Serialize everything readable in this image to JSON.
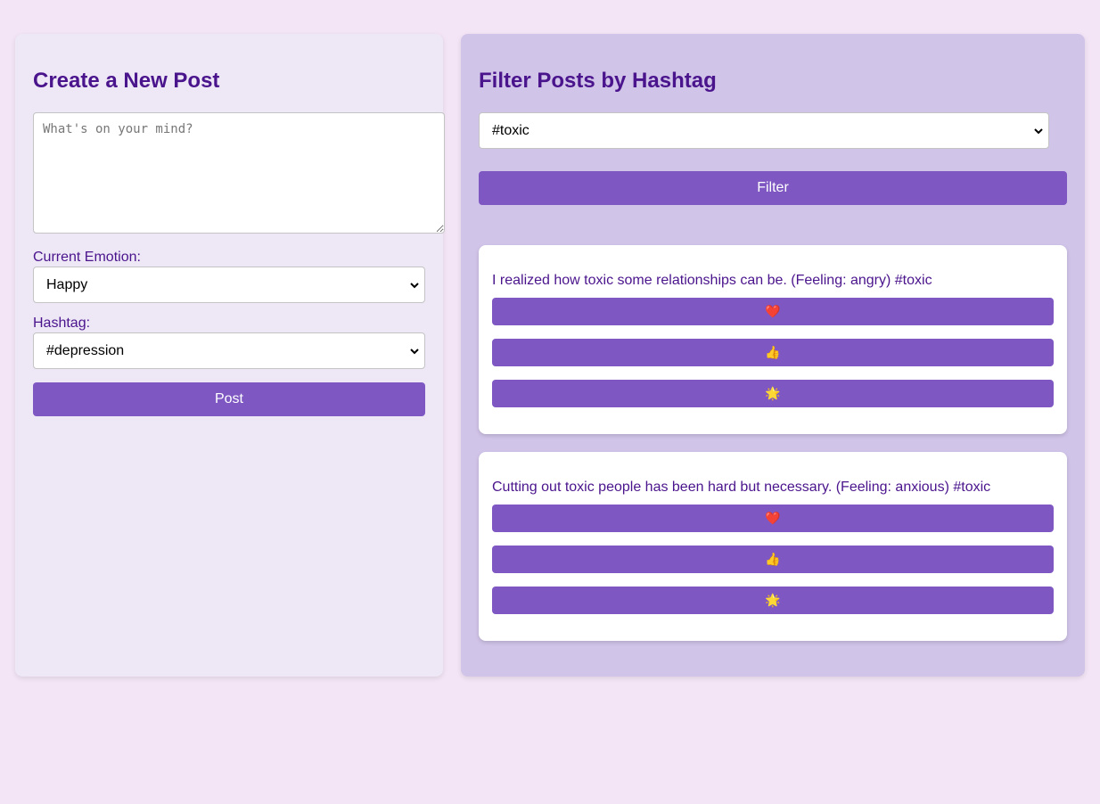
{
  "create_panel": {
    "title": "Create a New Post",
    "textarea_placeholder": "What's on your mind?",
    "emotion_label": "Current Emotion:",
    "emotion_selected": "Happy",
    "hashtag_label": "Hashtag:",
    "hashtag_selected": "#depression",
    "post_button": "Post"
  },
  "filter_panel": {
    "title": "Filter Posts by Hashtag",
    "hashtag_selected": "#toxic",
    "filter_button": "Filter"
  },
  "posts": [
    {
      "text": "I realized how toxic some relationships can be. (Feeling: angry) #toxic",
      "reactions": [
        "❤️",
        "👍",
        "🌟"
      ]
    },
    {
      "text": "Cutting out toxic people has been hard but necessary. (Feeling: anxious) #toxic",
      "reactions": [
        "❤️",
        "👍",
        "🌟"
      ]
    }
  ],
  "reaction_icons": [
    "heart-icon",
    "thumbs-up-icon",
    "sun-icon"
  ],
  "colors": {
    "page_background": "#f3e5f5",
    "left_panel": "#ede7f6",
    "right_panel": "#d1c4e9",
    "accent": "#7e57c2",
    "heading": "#4a148c"
  }
}
